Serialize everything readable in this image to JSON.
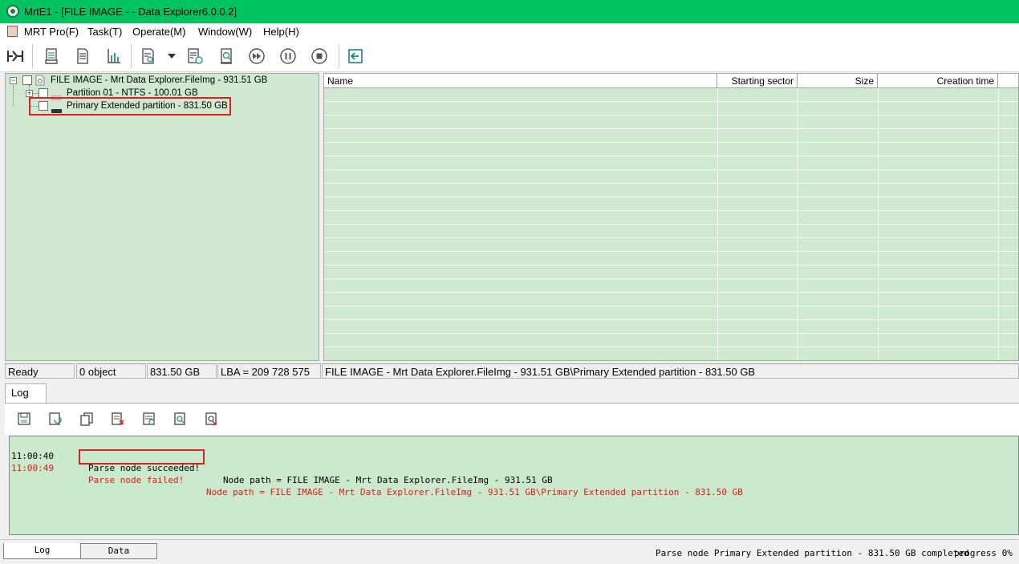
{
  "window": {
    "title": "MrtE1 - [FILE IMAGE -  - Data Explorer6.0.0.2]"
  },
  "menu": {
    "items": [
      "MRT Pro(F)",
      "Task(T)",
      "Operate(M)",
      "Window(W)",
      "Help(H)"
    ]
  },
  "toolbar": {
    "icons": [
      "connect-icon",
      "disk-info-icon",
      "document-icon",
      "chart-icon",
      "scan-icon",
      "dropdown-arrow-icon",
      "settings-list-icon",
      "search-doc-icon",
      "fast-forward-icon",
      "pause-icon",
      "stop-icon",
      "exit-icon"
    ]
  },
  "tree": {
    "root": {
      "label": "FILE IMAGE - Mrt Data Explorer.FileImg - 931.51 GB",
      "expander": "−"
    },
    "children": [
      {
        "label": "Partition 01 - NTFS - 100.01 GB",
        "expander": "+"
      },
      {
        "label": "Primary Extended partition - 831.50 GB",
        "expander": ""
      }
    ]
  },
  "list": {
    "columns": [
      "Name",
      "Starting sector",
      "Size",
      "Creation time"
    ]
  },
  "status": {
    "state": "Ready",
    "objects": "0 object",
    "size": "831.50 GB",
    "lba": "LBA = 209 728 575",
    "path": "FILE IMAGE - Mrt Data Explorer.FileImg - 931.51 GB\\Primary Extended partition - 831.50 GB"
  },
  "log": {
    "tab_label": "Log",
    "toolbar_icons": [
      "save-icon",
      "refresh-icon",
      "copy-icon",
      "clear-log-icon",
      "log-settings-icon",
      "find-icon",
      "export-icon"
    ],
    "entries": [
      {
        "time": "11:00:40",
        "message": "Parse node succeeded!",
        "path": "Node path = FILE IMAGE - Mrt Data Explorer.FileImg - 931.51 GB",
        "level": "ok"
      },
      {
        "time": "11:00:49",
        "message": "Parse node failed!",
        "path": "Node path = FILE IMAGE - Mrt Data Explorer.FileImg - 931.51 GB\\Primary Extended partition - 831.50 GB",
        "level": "error"
      }
    ]
  },
  "bottom": {
    "tabs": [
      "Log",
      "Data"
    ],
    "status_text": "Parse node Primary Extended partition - 831.50 GB completed",
    "progress_text": "progress 0%"
  },
  "colors": {
    "titlebar": "#00c45f",
    "pane_bg": "#cfe8cf",
    "log_bg": "#cae8cb",
    "error": "#e01818",
    "highlight": "#e02020"
  }
}
